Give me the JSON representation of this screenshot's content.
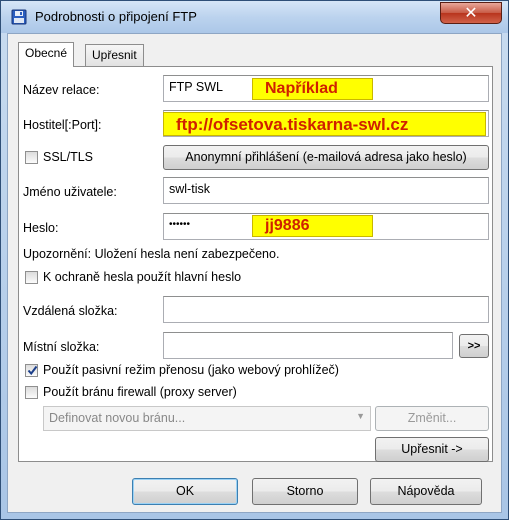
{
  "window": {
    "title": "Podrobnosti o připojení FTP",
    "close_glyph": "✕"
  },
  "tabs": [
    {
      "label": "Obecné",
      "active": true
    },
    {
      "label": "Upřesnit",
      "active": false
    }
  ],
  "form": {
    "session_name_label": "Název relace:",
    "session_name_value": "FTP SWL",
    "host_label": "Hostitel[:Port]:",
    "host_value": "",
    "ssl_label": "SSL/TLS",
    "ssl_checked": false,
    "anonymous_button": "Anonymní přihlášení (e-mailová adresa jako heslo)",
    "username_label": "Jméno uživatele:",
    "username_value": "swl-tisk",
    "password_label": "Heslo:",
    "password_value": "••••••",
    "warning_text": "Upozornění: Uložení hesla není zabezpečeno.",
    "master_password_label": "K ochraně hesla použít hlavní heslo",
    "master_password_checked": false,
    "remote_folder_label": "Vzdálená složka:",
    "remote_folder_value": "",
    "local_folder_label": "Místní složka:",
    "local_folder_value": "",
    "browse_button": ">>",
    "passive_label": "Použít pasivní režim přenosu (jako webový prohlížeč)",
    "passive_checked": true,
    "firewall_label": "Použít bránu firewall (proxy server)",
    "firewall_checked": false,
    "gateway_select": "Definovat novou bránu...",
    "change_button": "Změnit...",
    "advanced_button": "Upřesnit ->"
  },
  "annotations": {
    "example_label": "Například",
    "host_example": "ftp://ofsetova.tiskarna-swl.cz",
    "password_example": "jj9886"
  },
  "footer": {
    "ok": "OK",
    "cancel": "Storno",
    "help": "Nápověda"
  },
  "colors": {
    "highlight": "#ffff00",
    "highlight_text": "#d02000"
  }
}
